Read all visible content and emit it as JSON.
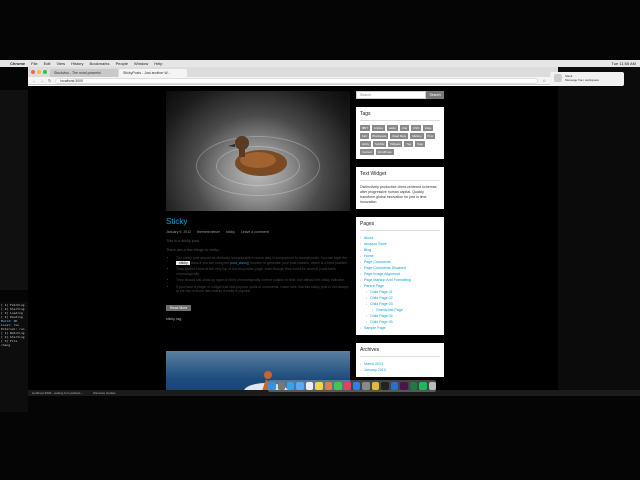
{
  "menubar": {
    "app": "Chrome",
    "items": [
      "File",
      "Edit",
      "View",
      "History",
      "Bookmarks",
      "People",
      "Window",
      "Help"
    ],
    "clock": "Tue 11:55 AM"
  },
  "browser": {
    "tabs": [
      {
        "label": "Stockviso - The most powerful"
      },
      {
        "label": "StickyPosts - Just another W..."
      }
    ],
    "url": "localhost:3000"
  },
  "post": {
    "title": "Sticky",
    "meta": [
      "January 9, 2012",
      "themereviewer",
      "sticky",
      "Leave a comment"
    ],
    "intro1": "This is a sticky post.",
    "intro2": "There are a few things to verify:",
    "bullets": [
      {
        "pre": "The sticky post should be distinctly recognizable in some way in comparison to normal posts. You can style the ",
        "hl": ".sticky",
        "mid": " class if you are using the ",
        "link": "post_class()",
        "post": " function to generate your post classes, which is a best practice."
      },
      {
        "pre": "They should show at the very top of the blog index page, even though they could be several posts back chronologically.",
        "hl": "",
        "mid": "",
        "link": "",
        "post": ""
      },
      {
        "pre": "They should still show up again in their chronologically correct postion in time, but without the sticky indicator.",
        "hl": "",
        "mid": "",
        "link": "",
        "post": ""
      },
      {
        "pre": "If you have a plugin or widget that lists popular posts or comments, make sure that this sticky post is not always at the top of those lists unless it really is popular.",
        "hl": "",
        "mid": "",
        "link": "",
        "post": ""
      }
    ],
    "read_more": "Read More",
    "tags": "sticky, tag"
  },
  "sidebar": {
    "search_placeholder": "Search",
    "search_button": "Search",
    "tags_title": "Tags",
    "tags": [
      "8BIT",
      "Articles",
      "aside",
      "chat",
      "CSS",
      "Edge",
      "Fail",
      "Blockquote",
      "Read More",
      "Markup",
      "Post",
      "sticky",
      "Subtitle",
      "Widgets",
      "Tag",
      "Tags",
      "Content",
      "WordPress"
    ],
    "text_title": "Text Widget",
    "text_body": "Distinctively productize client-centered schemas after progressive human capital. Quickly transform global innovation for just in time innovation.",
    "pages_title": "Pages",
    "pages": [
      {
        "label": "About",
        "children": []
      },
      {
        "label": "Amazon Store",
        "children": []
      },
      {
        "label": "Blog",
        "children": []
      },
      {
        "label": "Home",
        "children": []
      },
      {
        "label": "Page Comments",
        "children": []
      },
      {
        "label": "Page Comments Disabled",
        "children": []
      },
      {
        "label": "Page Image Alignment",
        "children": []
      },
      {
        "label": "Page Markup And Formatting",
        "children": []
      },
      {
        "label": "Parent Page",
        "children": [
          "Child Page 01",
          "Child Page 02",
          "Child Page 03",
          "Grandchild Page",
          "Child Page 04",
          "Child Page 05"
        ]
      },
      {
        "label": "Sample Page",
        "children": []
      }
    ],
    "archives_title": "Archives",
    "archives": [
      "March 2013",
      "January 2013"
    ]
  },
  "terminal": {
    "lines": [
      "[ 1] Fetching",
      "[ 2] Starting",
      "[ 3] Loading",
      "[ 4] Pending",
      "Build: OK",
      "Local: run",
      "External: run",
      "[ 1] Watching",
      "[ 2] Starting",
      "[ 3] File chang"
    ]
  },
  "statusbar": {
    "left": "localhost:3000 - waiting for localhost...",
    "right": "Windows Update"
  },
  "notification": {
    "title": "Slack",
    "body": "Message from workspace"
  },
  "colors": {
    "accent": "#0aa2d6",
    "page_bg": "#000000",
    "widget_bg": "#ffffff"
  }
}
